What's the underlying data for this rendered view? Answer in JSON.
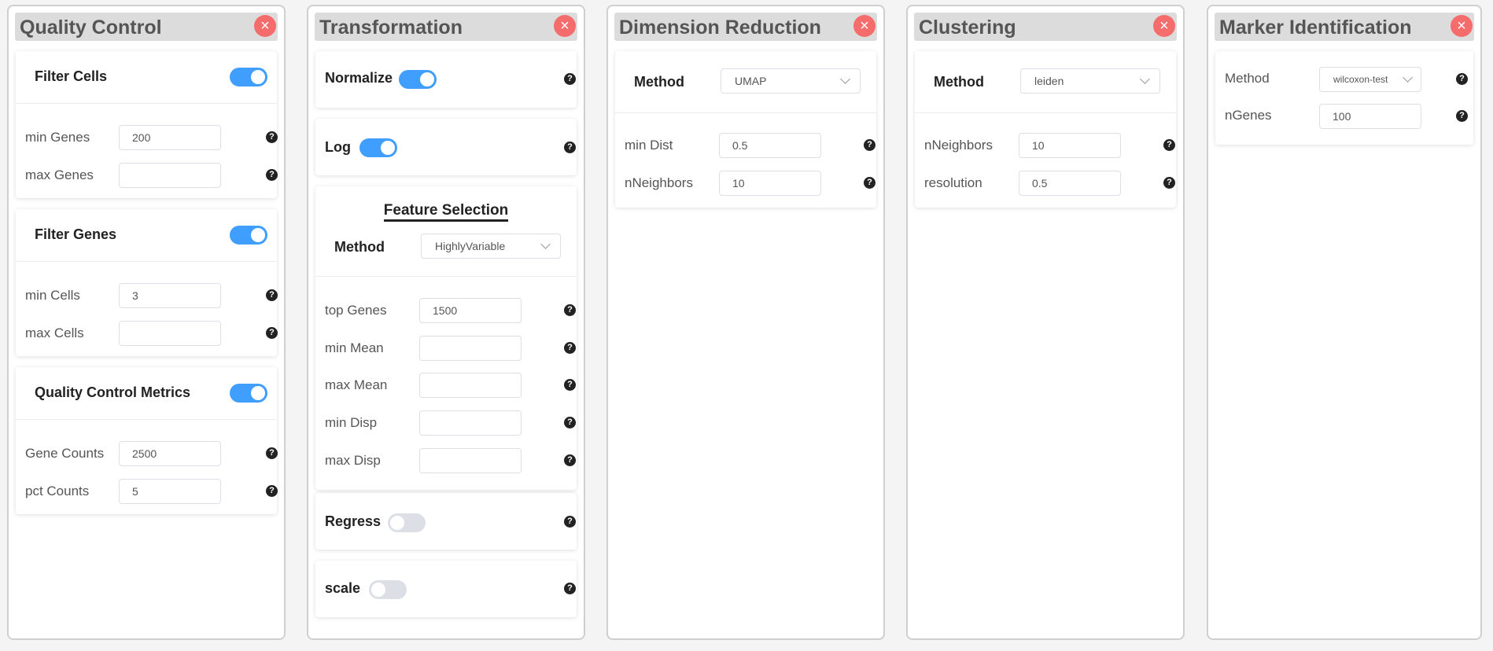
{
  "help_glyph": "?",
  "close_glyph": "×",
  "qc": {
    "title": "Quality Control",
    "filter_cells": {
      "title": "Filter Cells",
      "enabled": true,
      "min_genes_label": "min Genes",
      "min_genes": "200",
      "max_genes_label": "max Genes",
      "max_genes": ""
    },
    "filter_genes": {
      "title": "Filter Genes",
      "enabled": true,
      "min_cells_label": "min Cells",
      "min_cells": "3",
      "max_cells_label": "max Cells",
      "max_cells": ""
    },
    "metrics": {
      "title": "Quality Control Metrics",
      "enabled": true,
      "gene_counts_label": "Gene Counts",
      "gene_counts": "2500",
      "pct_counts_label": "pct Counts",
      "pct_counts": "5"
    }
  },
  "transformation": {
    "title": "Transformation",
    "normalize": {
      "label": "Normalize",
      "enabled": true
    },
    "log": {
      "label": "Log",
      "enabled": true
    },
    "feature_selection": {
      "title": "Feature Selection",
      "method_label": "Method",
      "method": "HighlyVariable",
      "top_genes_label": "top Genes",
      "top_genes": "1500",
      "min_mean_label": "min Mean",
      "min_mean": "",
      "max_mean_label": "max Mean",
      "max_mean": "",
      "min_disp_label": "min Disp",
      "min_disp": "",
      "max_disp_label": "max Disp",
      "max_disp": ""
    },
    "regress": {
      "label": "Regress",
      "enabled": false
    },
    "scale": {
      "label": "scale",
      "enabled": false
    }
  },
  "dimred": {
    "title": "Dimension Reduction",
    "method_label": "Method",
    "method": "UMAP",
    "min_dist_label": "min Dist",
    "min_dist": "0.5",
    "n_neighbors_label": "nNeighbors",
    "n_neighbors": "10"
  },
  "clustering": {
    "title": "Clustering",
    "method_label": "Method",
    "method": "leiden",
    "n_neighbors_label": "nNeighbors",
    "n_neighbors": "10",
    "resolution_label": "resolution",
    "resolution": "0.5"
  },
  "markers": {
    "title": "Marker Identification",
    "method_label": "Method",
    "method": "wilcoxon-test",
    "n_genes_label": "nGenes",
    "n_genes": "100"
  }
}
